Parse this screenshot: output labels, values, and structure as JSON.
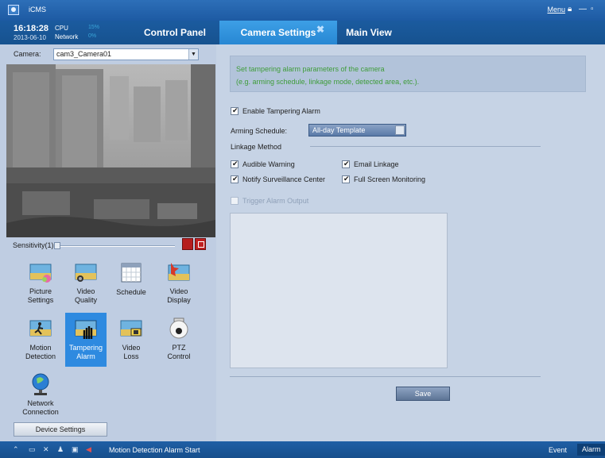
{
  "titlebar": {
    "app_name": "iCMS",
    "menu_label": "Menu",
    "lock_icon": "lock-icon",
    "minimize_icon": "minimize-icon",
    "restore_icon": "restore-icon"
  },
  "top_status": {
    "time": "16:18:28",
    "date": "2013-06-10",
    "cpu_label": "CPU",
    "cpu_value": "15%",
    "network_label": "Network",
    "network_value": "0%"
  },
  "tabs": [
    {
      "label": "Control Panel",
      "active": false
    },
    {
      "label": "Camera Settings",
      "active": true
    },
    {
      "label": "Main View",
      "active": false
    }
  ],
  "left": {
    "camera_label": "Camera:",
    "camera_value": "cam3_Camera01",
    "sensitivity_label": "Sensitivity(1)",
    "sensitivity_level": 0,
    "tools": [
      {
        "label1": "Picture",
        "label2": "Settings",
        "icon": "picture-settings-icon",
        "active": false
      },
      {
        "label1": "Video",
        "label2": "Quality",
        "icon": "video-quality-icon",
        "active": false
      },
      {
        "label1": "Schedule",
        "label2": "",
        "icon": "schedule-icon",
        "active": false
      },
      {
        "label1": "Video",
        "label2": "Display",
        "icon": "video-display-icon",
        "active": false
      },
      {
        "label1": "Motion",
        "label2": "Detection",
        "icon": "motion-detection-icon",
        "active": false
      },
      {
        "label1": "Tampering",
        "label2": "Alarm",
        "icon": "tampering-alarm-icon",
        "active": true
      },
      {
        "label1": "Video",
        "label2": "Loss",
        "icon": "video-loss-icon",
        "active": false
      },
      {
        "label1": "PTZ",
        "label2": "Control",
        "icon": "ptz-control-icon",
        "active": false
      },
      {
        "label1": "Network",
        "label2": "Connection",
        "icon": "network-connection-icon",
        "active": false
      }
    ],
    "device_settings_label": "Device Settings"
  },
  "right": {
    "info_line1": "Set tampering alarm parameters of the camera",
    "info_line2": "(e.g. arming schedule, linkage mode, detected area, etc.).",
    "enable_label": "Enable Tampering Alarm",
    "enable_checked": true,
    "arming_label": "Arming Schedule:",
    "arming_value": "All-day Template",
    "linkage_label": "Linkage Method",
    "audible_label": "Audible Warning",
    "email_label": "Email Linkage",
    "notify_label": "Notify Surveillance Center",
    "fullscreen_label": "Full Screen Monitoring",
    "trigger_label": "Trigger Alarm Output",
    "save_label": "Save"
  },
  "statusbar": {
    "message": "Motion Detection Alarm Start",
    "event_label": "Event",
    "alarm_label": "Alarm"
  }
}
